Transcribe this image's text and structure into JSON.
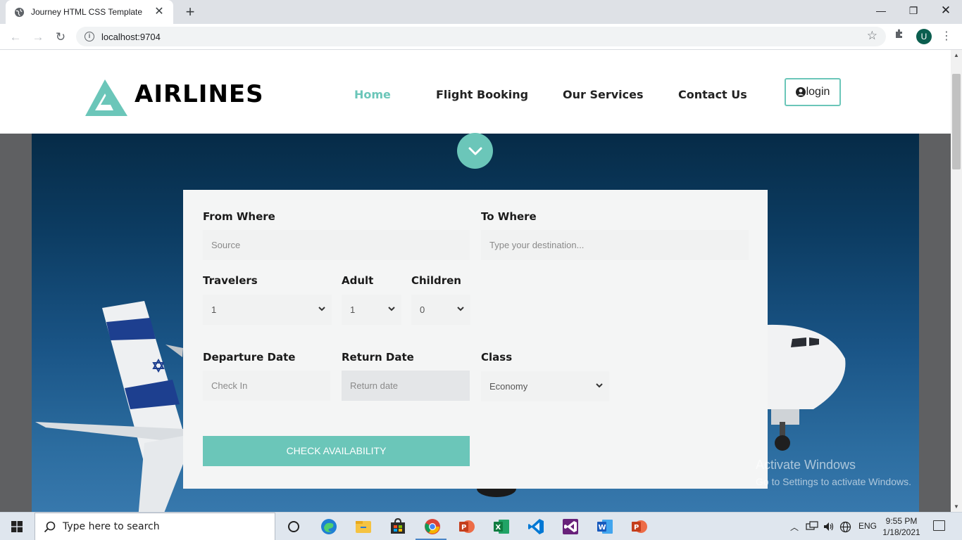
{
  "browser": {
    "tab_title": "Journey HTML CSS Template",
    "url": "localhost:9704",
    "profile_initial": "U"
  },
  "site": {
    "brand": "AIRLINES",
    "nav": [
      "Home",
      "Flight Booking",
      "Our Services",
      "Contact Us"
    ],
    "login_label": "login",
    "accent_color": "#6bc6b9"
  },
  "form": {
    "from_label": "From Where",
    "from_placeholder": "Source",
    "to_label": "To Where",
    "to_placeholder": "Type your destination...",
    "travelers_label": "Travelers",
    "travelers_value": "1",
    "adult_label": "Adult",
    "adult_value": "1",
    "children_label": "Children",
    "children_value": "0",
    "departure_label": "Departure Date",
    "departure_placeholder": "Check In",
    "return_label": "Return Date",
    "return_placeholder": "Return date",
    "class_label": "Class",
    "class_value": "Economy",
    "submit_label": "CHECK AVAILABILITY"
  },
  "watermark": {
    "line1": "Activate Windows",
    "line2": "Go to Settings to activate Windows."
  },
  "taskbar": {
    "search_placeholder": "Type here to search",
    "language": "ENG",
    "time": "9:55 PM",
    "date": "1/18/2021",
    "apps": [
      "task-view",
      "edge",
      "file-explorer",
      "store",
      "chrome",
      "powerpoint",
      "excel",
      "vscode",
      "visual-studio",
      "word",
      "powerpoint"
    ]
  }
}
